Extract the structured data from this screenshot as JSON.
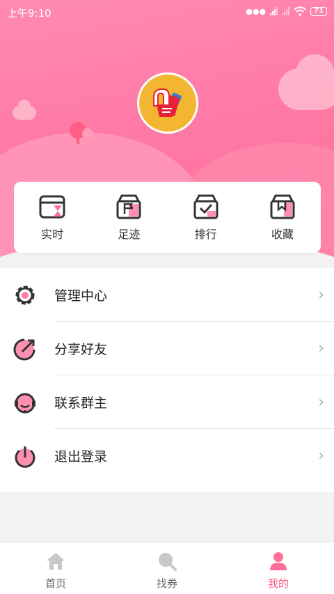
{
  "status_bar": {
    "time": "上午9:10",
    "battery": "71"
  },
  "quick_actions": [
    {
      "label": "实时",
      "icon": "hourglass-box-icon"
    },
    {
      "label": "足迹",
      "icon": "flag-box-icon"
    },
    {
      "label": "排行",
      "icon": "check-box-icon"
    },
    {
      "label": "收藏",
      "icon": "bookmark-box-icon"
    }
  ],
  "menu": [
    {
      "label": "管理中心",
      "icon": "gear-icon"
    },
    {
      "label": "分享好友",
      "icon": "share-arrow-icon"
    },
    {
      "label": "联系群主",
      "icon": "headset-icon"
    },
    {
      "label": "退出登录",
      "icon": "power-icon"
    }
  ],
  "tabs": [
    {
      "label": "首页",
      "icon": "home-icon",
      "active": false
    },
    {
      "label": "找券",
      "icon": "search-icon",
      "active": false
    },
    {
      "label": "我的",
      "icon": "person-icon",
      "active": true
    }
  ],
  "colors": {
    "accent": "#ff4f7b",
    "hero": "#ff7aa6",
    "avatar_bg": "#f4b630"
  }
}
